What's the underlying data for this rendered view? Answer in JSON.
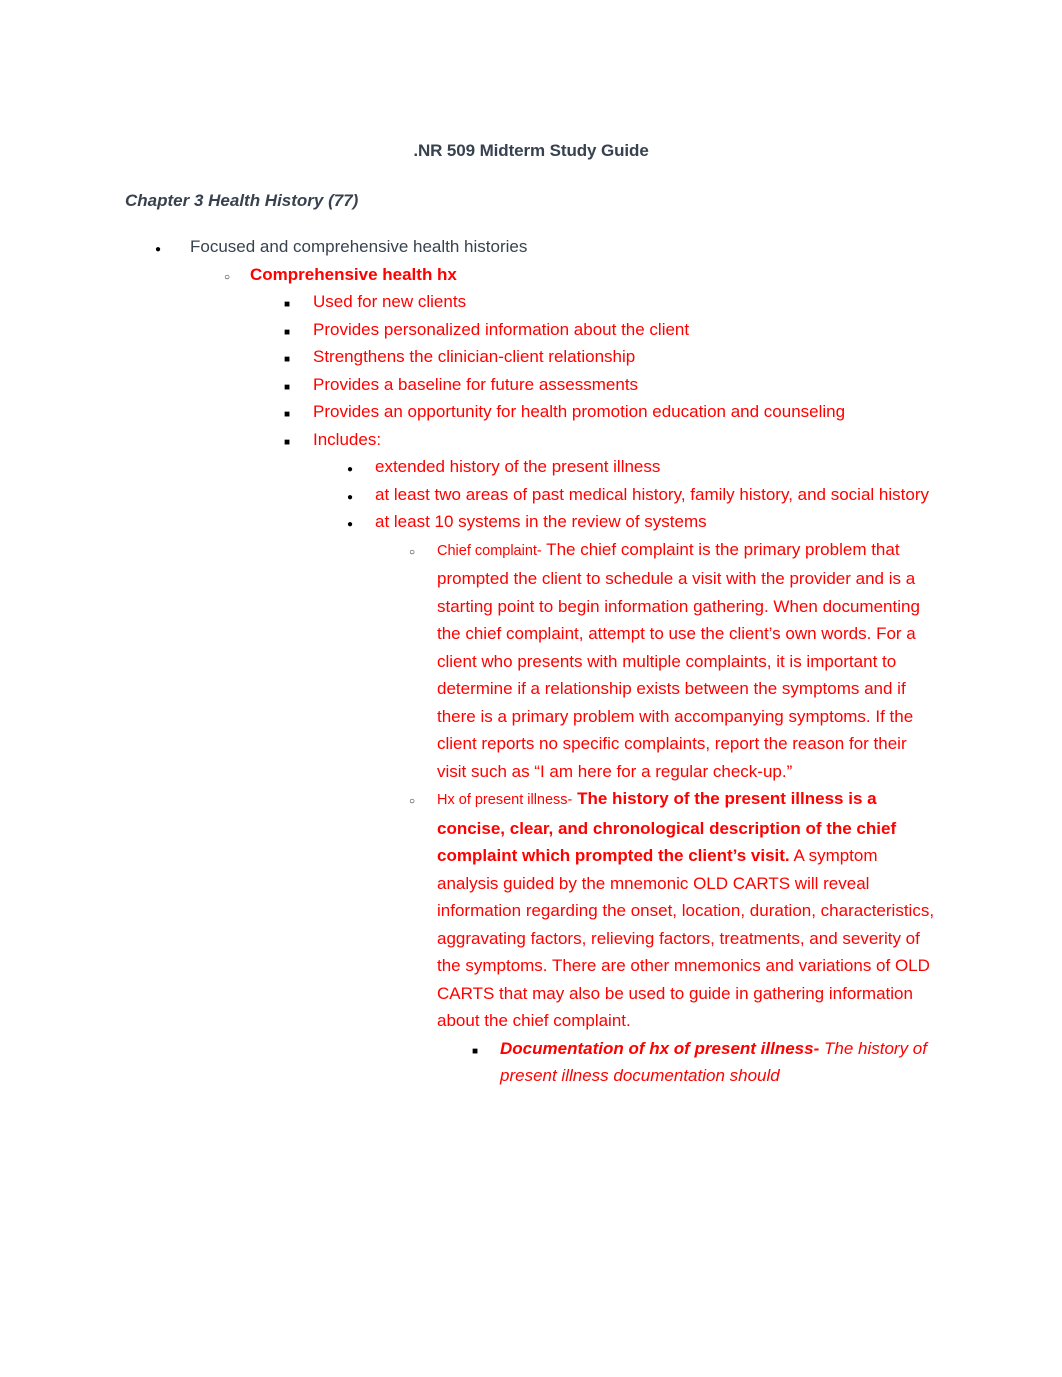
{
  "document": {
    "title": ".NR 509 Midterm Study Guide",
    "chapter_heading": "Chapter 3 Health History (77)",
    "colors": {
      "body_text": "#38424f",
      "highlight_text": "#ff0000",
      "bullet_marker": "#000000",
      "page_background": "#ffffff"
    }
  },
  "outline": {
    "level1_focused": "Focused and comprehensive health histories",
    "level2_comprehensive": "Comprehensive health hx",
    "level3_items": [
      "Used for new clients",
      "Provides personalized information about the client",
      "Strengthens the clinician-client relationship",
      "Provides a baseline for future assessments",
      "Provides an opportunity for health promotion education and counseling",
      "Includes:"
    ],
    "level4_items": [
      "extended history of the present illness",
      "at least two areas of past medical history, family history, and social history",
      "at least 10 systems in the review of systems"
    ],
    "chief_complaint": {
      "label": "Chief complaint-",
      "body": " The chief complaint is the primary problem that prompted the client to schedule a visit with the provider and is a starting point to begin information gathering. When documenting the chief complaint, attempt to use the client’s own words. For a client who presents with multiple complaints, it is important to determine if a relationship exists between the symptoms and if there is a primary problem with accompanying symptoms. If the client reports no specific complaints, report the reason for their visit such as “I am here for a regular check-up.”"
    },
    "hx_present_illness": {
      "label": "Hx of present illness-",
      "bold_body": " The history of the present illness is a concise, clear, and chronological description of the chief complaint which prompted the client’s visit.",
      "body": " A symptom analysis guided by the mnemonic OLD CARTS will reveal information regarding the onset, location, duration, characteristics, aggravating factors, relieving factors, treatments, and severity of the symptoms. There are other mnemonics and variations of OLD CARTS that may also be used to guide in gathering information about the chief complaint."
    },
    "documentation_hx": {
      "label": "Documentation of hx of present illness-",
      "body": "  The history of present illness documentation should"
    }
  },
  "markers": {
    "disc": "●",
    "circle": "○",
    "square": "■"
  }
}
